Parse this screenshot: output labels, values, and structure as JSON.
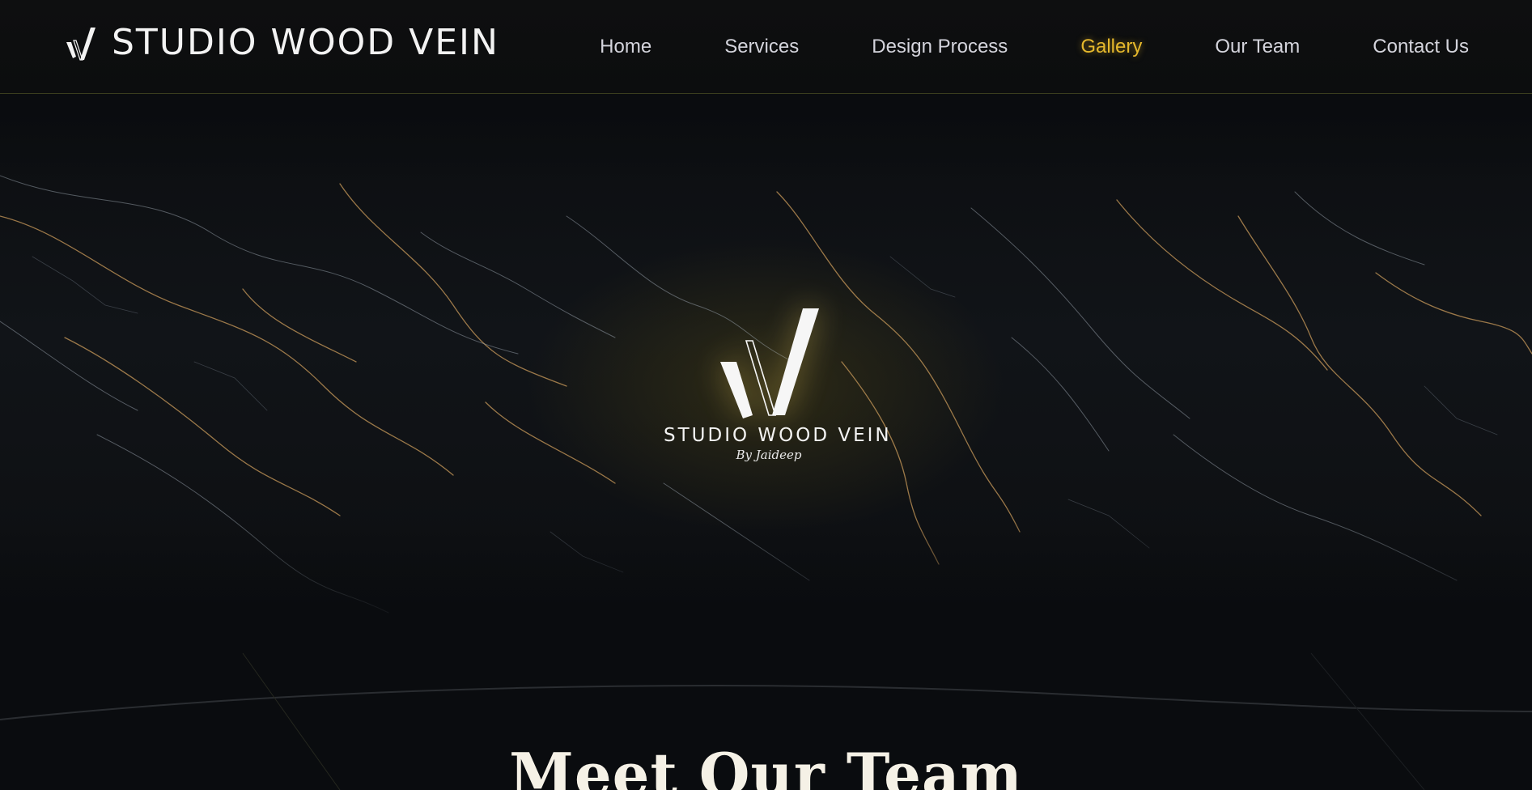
{
  "header": {
    "brand_name": "STUDIO WOOD VEIN",
    "brand_icon": "vw-monogram-icon",
    "nav": [
      {
        "label": "Home",
        "active": false
      },
      {
        "label": "Services",
        "active": false
      },
      {
        "label": "Design Process",
        "active": false
      },
      {
        "label": "Gallery",
        "active": true
      },
      {
        "label": "Our Team",
        "active": false
      },
      {
        "label": "Contact Us",
        "active": false
      }
    ]
  },
  "hero": {
    "logo_text": "STUDIO WOOD VEIN",
    "logo_signature": "By Jaideep",
    "logo_icon": "vw-monogram-icon",
    "background": "black-marble-gold-veins"
  },
  "team_section": {
    "title": "Meet Our Team"
  },
  "colors": {
    "background": "#0a0c0f",
    "accent_gold": "#e5b82c",
    "nav_text": "#d4d4dc",
    "title_text": "#f5f1e6"
  }
}
